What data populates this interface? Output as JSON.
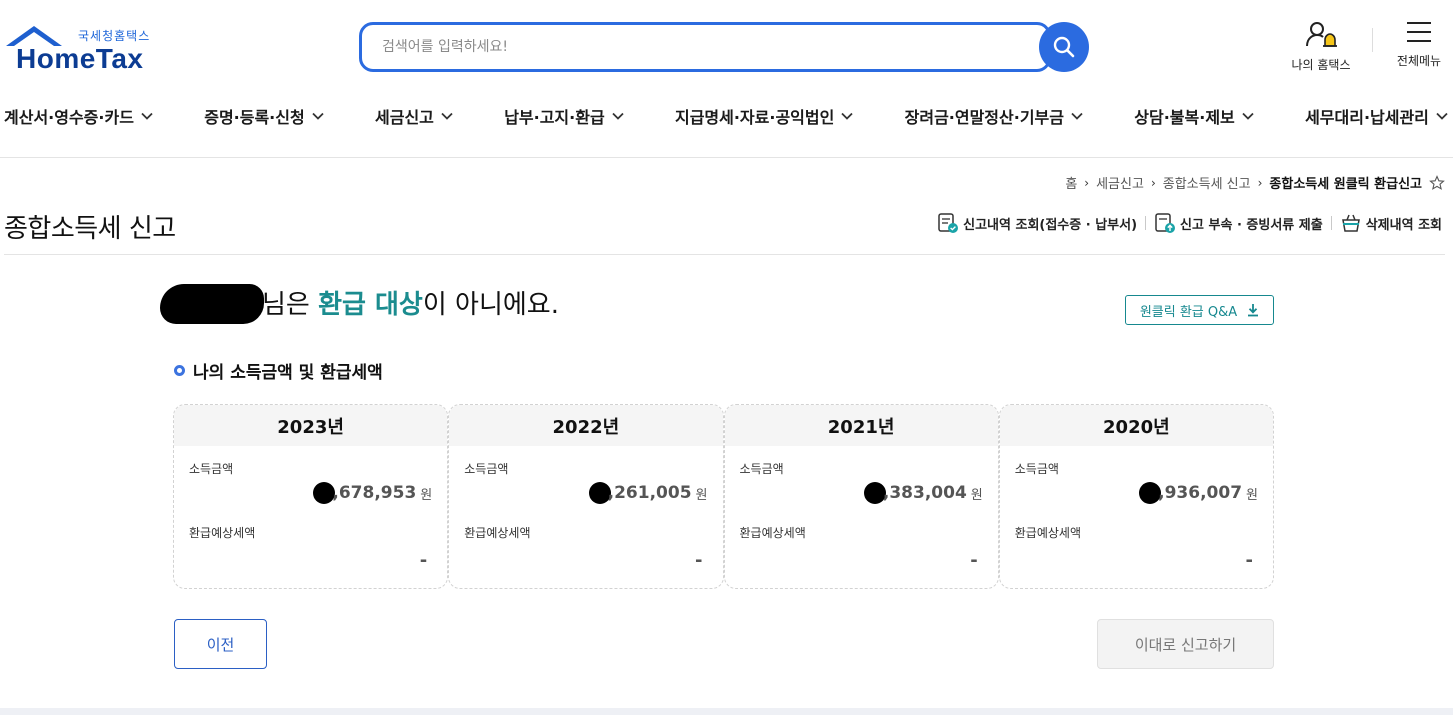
{
  "header": {
    "logo_sub": "국세청홈택스",
    "logo_main": "HomeTax",
    "search_placeholder": "검색어를 입력하세요!",
    "search_value": "",
    "my_hometax": "나의 홈택스",
    "all_menu": "전체메뉴",
    "icons": {
      "search": "search-icon",
      "user": "user-bell-icon",
      "menu": "hamburger-icon"
    }
  },
  "nav": {
    "items": [
      "계산서·영수증·카드",
      "증명·등록·신청",
      "세금신고",
      "납부·고지·환급",
      "지급명세·자료·공익법인",
      "장려금·연말정산·기부금",
      "상담·불복·제보",
      "세무대리·납세관리"
    ]
  },
  "breadcrumb": {
    "items": [
      "홈",
      "세금신고",
      "종합소득세 신고"
    ],
    "current": "종합소득세 원클릭 환급신고"
  },
  "page": {
    "title": "종합소득세 신고",
    "actions": [
      "신고내역 조회(접수증 · 납부서)",
      "신고 부속 · 증빙서류 제출",
      "삭제내역 조회"
    ]
  },
  "result": {
    "msg_suffix_1": "님은 ",
    "msg_highlight": "환급 대상",
    "msg_suffix_2": "이 아니에요.",
    "qa_button": "원클릭 환급 Q&A"
  },
  "section": {
    "title": "나의 소득금액 및 환급세액",
    "income_label": "소득금액",
    "refund_label": "환급예상세액",
    "unit": "원"
  },
  "years": [
    {
      "year": "2023년",
      "income": ",678,953",
      "refund": "-"
    },
    {
      "year": "2022년",
      "income": ",261,005",
      "refund": "-"
    },
    {
      "year": "2021년",
      "income": ",383,004",
      "refund": "-"
    },
    {
      "year": "2020년",
      "income": ",936,007",
      "refund": "-"
    }
  ],
  "buttons": {
    "prev": "이전",
    "submit": "이대로 신고하기"
  },
  "colors": {
    "brand_blue": "#2b6be0",
    "logo_navy": "#0c3c93",
    "teal": "#1b8c8f"
  }
}
